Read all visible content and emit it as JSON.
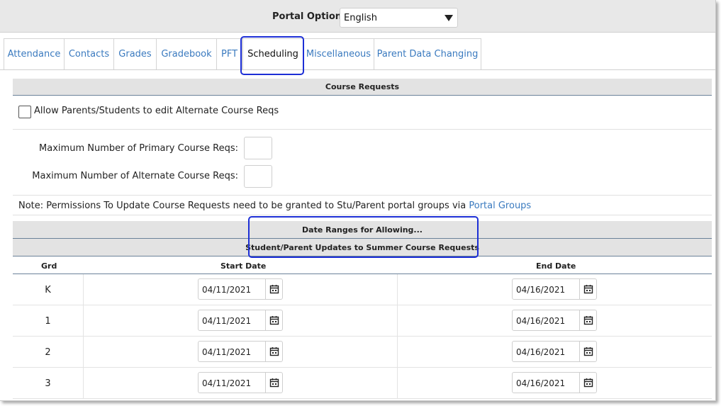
{
  "header": {
    "portal_options_label": "Portal Options:",
    "language_selected": "English"
  },
  "tabs": [
    {
      "label": "Attendance",
      "active": false
    },
    {
      "label": "Contacts",
      "active": false
    },
    {
      "label": "Grades",
      "active": false
    },
    {
      "label": "Gradebook",
      "active": false
    },
    {
      "label": "PFT",
      "active": false
    },
    {
      "label": "Scheduling",
      "active": true
    },
    {
      "label": "Miscellaneous",
      "active": false
    },
    {
      "label": "Parent Data Changing",
      "active": false
    }
  ],
  "course_requests": {
    "title": "Course Requests",
    "allow_alternate_label": "Allow Parents/Students to edit Alternate Course Reqs",
    "allow_alternate_checked": false,
    "max_primary_label": "Maximum Number of Primary Course Reqs:",
    "max_primary_value": "",
    "max_alternate_label": "Maximum Number of Alternate Course Reqs:",
    "max_alternate_value": "",
    "note_text": "Note: Permissions To Update Course Requests need to be granted to Stu/Parent portal groups via",
    "note_link": "Portal Groups"
  },
  "date_ranges": {
    "title": "Date Ranges for Allowing...",
    "subtitle": "Student/Parent Updates to Summer Course Requests",
    "columns": {
      "grade": "Grd",
      "start": "Start Date",
      "end": "End Date"
    },
    "rows": [
      {
        "grade": "K",
        "start": "04/11/2021",
        "end": "04/16/2021"
      },
      {
        "grade": "1",
        "start": "04/11/2021",
        "end": "04/16/2021"
      },
      {
        "grade": "2",
        "start": "04/11/2021",
        "end": "04/16/2021"
      },
      {
        "grade": "3",
        "start": "04/11/2021",
        "end": "04/16/2021"
      }
    ]
  },
  "colors": {
    "link": "#3a7abf",
    "highlight": "#1d2fd6",
    "header_bg": "#e3e3e3"
  }
}
